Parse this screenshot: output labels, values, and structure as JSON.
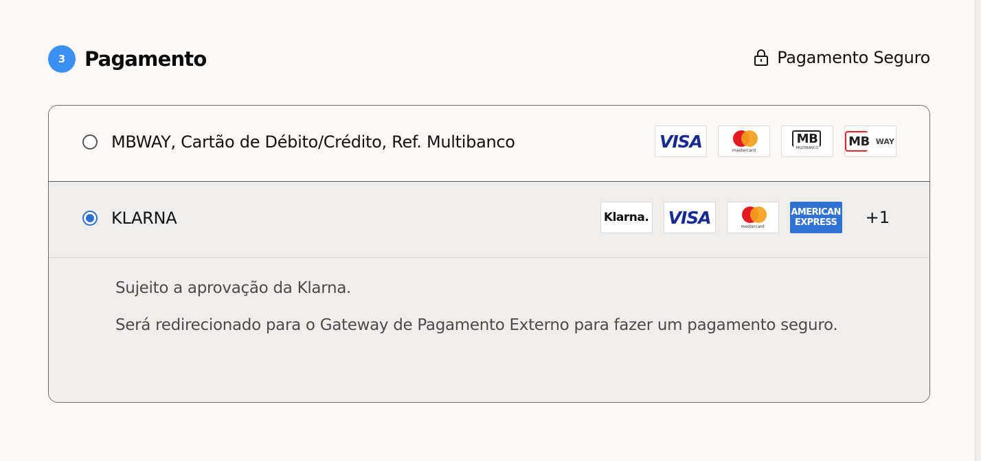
{
  "header": {
    "step_number": "3",
    "title": "Pagamento",
    "secure_label": "Pagamento Seguro"
  },
  "payment_options": [
    {
      "label": "MBWAY, Cartão de Débito/Crédito, Ref. Multibanco",
      "selected": false,
      "logos": [
        "VISA",
        "mastercard",
        "MB",
        "MB WAY"
      ]
    },
    {
      "label": "KLARNA",
      "selected": true,
      "logos": [
        "Klarna.",
        "VISA",
        "mastercard",
        "AMERICAN EXPRESS"
      ],
      "more": "+1",
      "details": [
        "Sujeito a aprovação da Klarna.",
        "Será redirecionado para o Gateway de Pagamento Externo para fazer um pagamento seguro."
      ]
    }
  ],
  "logo_text": {
    "visa": "VISA",
    "mastercard": "mastercard",
    "mb": "MB",
    "multibanco": "MULTIBANCO",
    "way": "WAY",
    "klarna": "Klarna.",
    "amex_1": "AMERICAN",
    "amex_2": "EXPRESS"
  },
  "colors": {
    "accent": "#3b8ff0",
    "radio_selected": "#2f6fd1",
    "page_bg": "#fcf8f6",
    "selected_bg": "#f0eeec",
    "visa_blue": "#1a2a93",
    "amex_blue": "#2f72d3",
    "mastercard_red": "#e41b22",
    "mastercard_yellow": "#f49f1b",
    "mbway_red": "#e0262b"
  },
  "icons": [
    "lock-icon",
    "visa-logo",
    "mastercard-logo",
    "multibanco-logo",
    "mbway-logo",
    "klarna-logo",
    "amex-logo"
  ]
}
